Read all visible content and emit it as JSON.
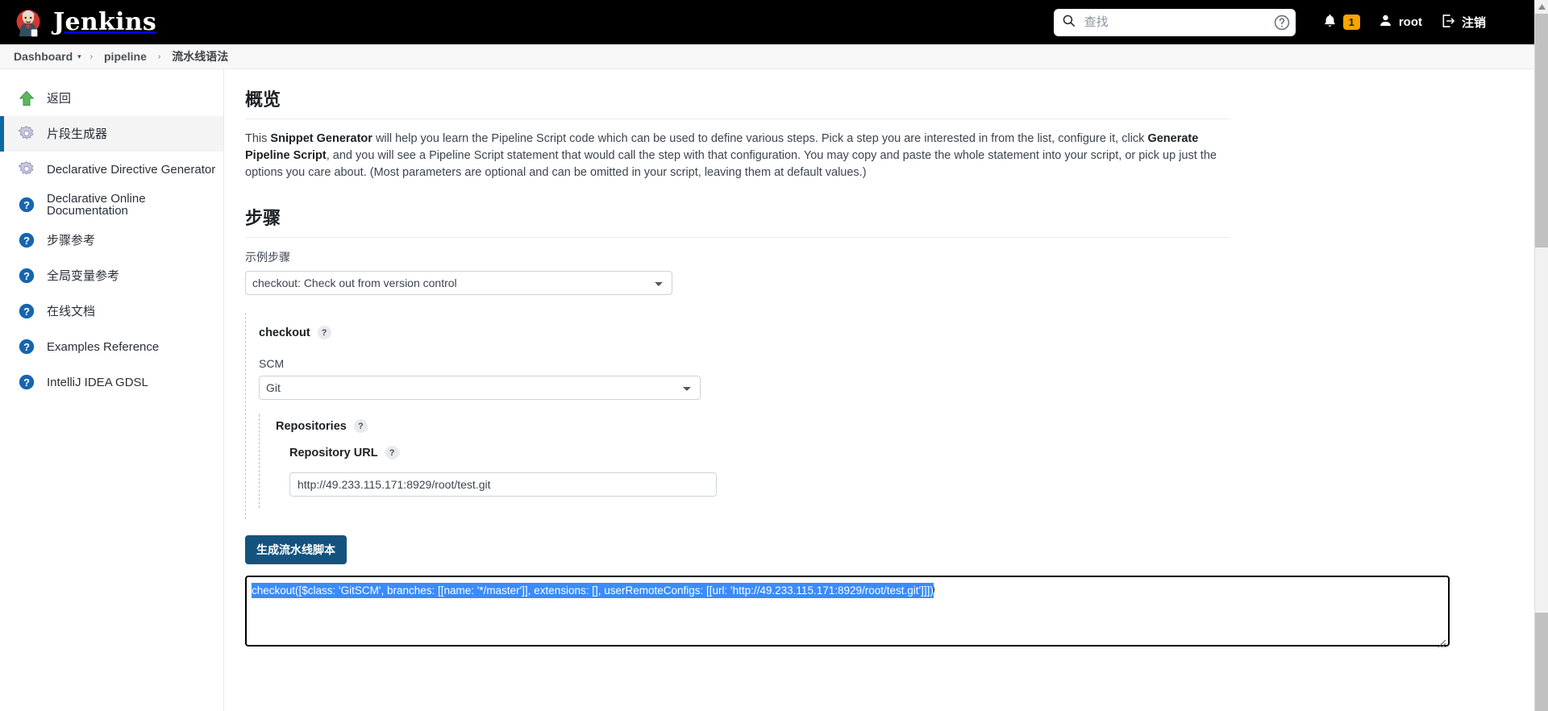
{
  "header": {
    "brand": "Jenkins",
    "logo_icon": "jenkins-butler-logo",
    "search": {
      "placeholder": "查找",
      "value": "",
      "icon": "search-icon",
      "help_icon": "question-circle-icon"
    },
    "notifications": {
      "icon": "bell-icon",
      "count": "1"
    },
    "user": {
      "icon": "person-icon",
      "label": "root"
    },
    "logout": {
      "icon": "logout-icon",
      "label": "注销"
    }
  },
  "breadcrumb": {
    "items": [
      {
        "label": "Dashboard",
        "has_caret": true
      },
      {
        "label": "pipeline",
        "has_caret": false
      },
      {
        "label": "流水线语法",
        "has_caret": false
      }
    ],
    "separator": "›",
    "caret": "▾"
  },
  "sidebar": {
    "items": [
      {
        "label": "返回",
        "icon": "up-arrow-icon",
        "active": false
      },
      {
        "label": "片段生成器",
        "icon": "gear-icon",
        "active": true
      },
      {
        "label": "Declarative Directive Generator",
        "icon": "gear-icon",
        "active": false
      },
      {
        "label": "Declarative Online Documentation",
        "icon": "help-icon",
        "active": false
      },
      {
        "label": "步骤参考",
        "icon": "help-icon",
        "active": false
      },
      {
        "label": "全局变量参考",
        "icon": "help-icon",
        "active": false
      },
      {
        "label": "在线文档",
        "icon": "help-icon",
        "active": false
      },
      {
        "label": "Examples Reference",
        "icon": "help-icon",
        "active": false
      },
      {
        "label": "IntelliJ IDEA GDSL",
        "icon": "help-icon",
        "active": false
      }
    ]
  },
  "main": {
    "overview": {
      "title": "概览",
      "text_1": "This ",
      "bold_1": "Snippet Generator",
      "text_2": " will help you learn the Pipeline Script code which can be used to define various steps. Pick a step you are interested in from the list, configure it, click ",
      "bold_2": "Generate Pipeline Script",
      "text_3": ", and you will see a Pipeline Script statement that would call the step with that configuration. You may copy and paste the whole statement into your script, or pick up just the options you care about. (Most parameters are optional and can be omitted in your script, leaving them at default values.)"
    },
    "steps": {
      "title": "步骤",
      "sample_step_label": "示例步骤",
      "sample_step_value": "checkout: Check out from version control",
      "sample_step_options": [
        "checkout: Check out from version control"
      ]
    },
    "checkout": {
      "title": "checkout",
      "help": "?",
      "scm_label": "SCM",
      "scm_value": "Git",
      "scm_options": [
        "Git"
      ],
      "repositories": {
        "title": "Repositories",
        "help": "?",
        "repository_url": {
          "label": "Repository URL",
          "help": "?",
          "value": "http://49.233.115.171:8929/root/test.git",
          "placeholder": ""
        }
      }
    },
    "generate_button": "生成流水线脚本",
    "output": {
      "value": "checkout([$class: 'GitSCM', branches: [[name: '*/master']], extensions: [], userRemoteConfigs: [[url: 'http://49.233.115.171:8929/root/test.git']]])",
      "selected": true
    }
  },
  "colors": {
    "accent": "#0b6aa2",
    "button": "#14537e",
    "badge": "#f8a401",
    "selection": "#3a8bfc",
    "header_bg": "#000000"
  },
  "scrollbar": {
    "up_arrow": "▲",
    "visible": true
  }
}
